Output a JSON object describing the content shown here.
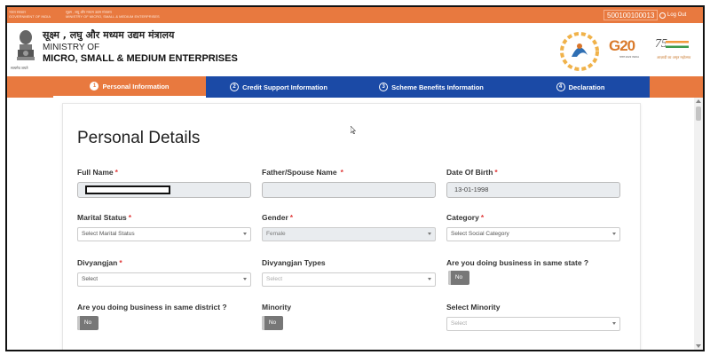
{
  "topbar": {
    "gov_hindi": "भारत सरकार",
    "gov_english": "GOVERNMENT OF INDIA",
    "ministry_hindi_small": "सूक्ष्म , लघु और मध्यम उद्यम मंत्रालय",
    "ministry_english_small": "MINISTRY OF MICRO, SMALL & MEDIUM ENTERPRISES",
    "application_number": "500100100013",
    "logout_label": "Log Out"
  },
  "header": {
    "emblem_caption": "सत्यमेव जयते",
    "ministry_hindi": "सूक्ष्म , लघु और मध्यम उद्यम मंत्रालय",
    "ministry_of": "MINISTRY OF",
    "ministry_name": "MICRO, SMALL & MEDIUM ENTERPRISES",
    "g20_text": "G20",
    "azadi_number": "75",
    "azadi_text": "आज़ादी का अमृत महोत्सव"
  },
  "steps": [
    {
      "num": "1",
      "label": "Personal Information",
      "active": true
    },
    {
      "num": "2",
      "label": "Credit Support Information",
      "active": false
    },
    {
      "num": "3",
      "label": "Scheme Benefits Information",
      "active": false
    },
    {
      "num": "4",
      "label": "Declaration",
      "active": false
    }
  ],
  "form": {
    "title": "Personal Details",
    "full_name": {
      "label": "Full Name",
      "required": "*"
    },
    "father_name": {
      "label": "Father/Spouse Name",
      "required": "*",
      "value": ""
    },
    "dob": {
      "label": "Date Of Birth",
      "required": "*",
      "value": "13-01-1998"
    },
    "marital_status": {
      "label": "Marital Status",
      "required": "*",
      "value": "Select Marital Status"
    },
    "gender": {
      "label": "Gender",
      "required": "*",
      "value": "Female"
    },
    "category": {
      "label": "Category",
      "required": "*",
      "value": "Select Social Category"
    },
    "divyangjan": {
      "label": "Divyangjan",
      "required": "*",
      "value": "Select"
    },
    "divyangjan_types": {
      "label": "Divyangjan Types",
      "value": "Select"
    },
    "same_state": {
      "label": "Are you doing business in same state ?",
      "value": "No"
    },
    "same_district": {
      "label": "Are you doing business in same district ?",
      "value": "No"
    },
    "minority": {
      "label": "Minority",
      "value": "No"
    },
    "select_minority": {
      "label": "Select Minority",
      "value": "Select"
    }
  },
  "colors": {
    "accent_orange": "#e8793f",
    "nav_blue": "#1b4aa6",
    "required_red": "#e03a3a"
  }
}
